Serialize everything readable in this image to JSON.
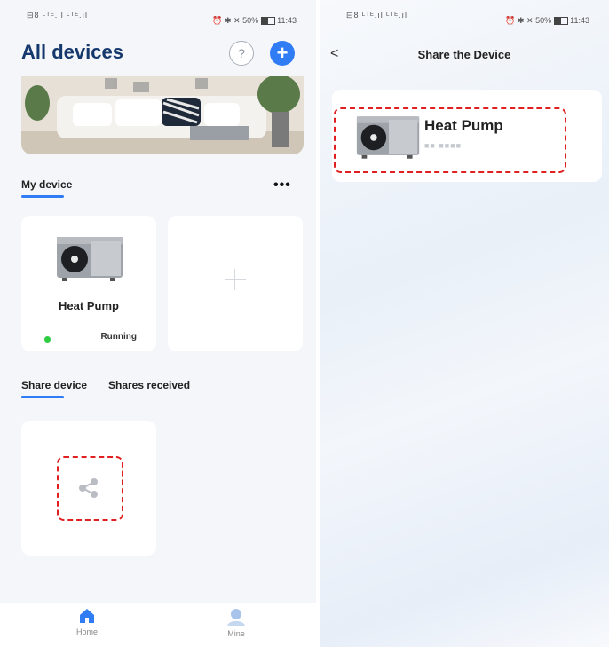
{
  "status_bar": {
    "left_signal": "⊟8 ᴸᵀᴱ.ıl ᴸᵀᴱ.ıl",
    "right_info": "50%",
    "time": "11:43"
  },
  "home": {
    "title": "All devices",
    "help_label": "?",
    "add_label": "+",
    "my_device_title": "My device",
    "more_label": "•••",
    "devices": [
      {
        "name": "Heat Pump",
        "status": "Running",
        "status_color": "#2ecc40"
      }
    ],
    "share_tabs": [
      "Share device",
      "Shares received"
    ],
    "tabbar": [
      {
        "label": "Home",
        "icon": "home-icon",
        "active": true
      },
      {
        "label": "Mine",
        "icon": "user-icon",
        "active": false
      }
    ]
  },
  "share_page": {
    "back_label": "<",
    "title": "Share the Device",
    "device_name": "Heat Pump",
    "device_sub": "■■  ■■■■"
  },
  "colors": {
    "accent": "#2f7cf5",
    "title": "#15386d",
    "highlight": "#e02020"
  }
}
